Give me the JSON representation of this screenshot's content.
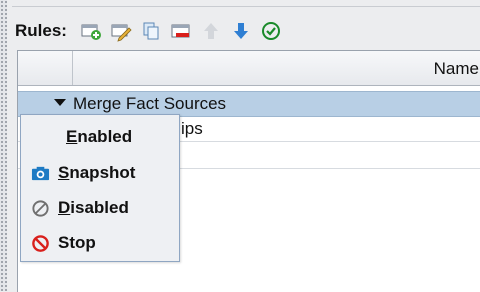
{
  "toolbar": {
    "label": "Rules:",
    "buttons": [
      {
        "icon": "add-rule-icon"
      },
      {
        "icon": "edit-rule-icon"
      },
      {
        "icon": "copy-rule-icon"
      },
      {
        "icon": "delete-rule-icon"
      },
      {
        "icon": "move-up-icon"
      },
      {
        "icon": "move-down-icon"
      },
      {
        "icon": "validate-icon"
      }
    ]
  },
  "table": {
    "header": {
      "name": "Name"
    },
    "rows": [
      {
        "label": "Merge Fact Sources",
        "expanded": true,
        "selected": true
      },
      {
        "label": "ips"
      }
    ]
  },
  "context_menu": {
    "items": [
      {
        "pre": "",
        "mnemonic": "E",
        "rest": "nabled",
        "icon": ""
      },
      {
        "pre": "",
        "mnemonic": "S",
        "rest": "napshot",
        "icon": "camera-icon"
      },
      {
        "pre": "",
        "mnemonic": "D",
        "rest": "isabled",
        "icon": "disabled-icon"
      },
      {
        "pre": "S",
        "mnemonic": "",
        "rest": "top",
        "icon": "stop-icon"
      }
    ]
  },
  "colors": {
    "selection": "#b8cfe5",
    "menu_border": "#8fa6c2",
    "stop_red": "#d9201c",
    "camera_blue": "#1e7bc4"
  }
}
